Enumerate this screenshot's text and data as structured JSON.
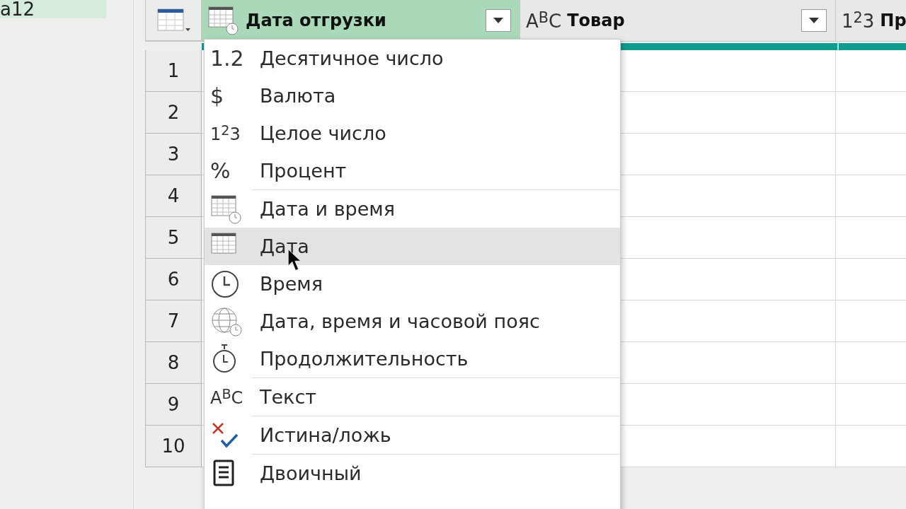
{
  "queries": [
    {
      "name": "а12",
      "selected": true
    }
  ],
  "table": {
    "columns": [
      {
        "name": "Дата отгрузки",
        "kind": "datetime",
        "selected": true,
        "has_dropdown": true
      },
      {
        "name": "Товар",
        "kind": "glyph",
        "glyph": "A$^{B}$C",
        "selected": false,
        "has_dropdown": true
      },
      {
        "name": "Пр",
        "kind": "glyph",
        "glyph": "1$^{2}$3",
        "selected": false
      }
    ],
    "row_numbers": [
      "1",
      "2",
      "3",
      "4",
      "5",
      "6",
      "7",
      "8",
      "9",
      "10"
    ]
  },
  "type_menu": {
    "groups": [
      [
        {
          "kind": "glyph",
          "glyph": "1.2",
          "label": "Десятичное число",
          "selected": false
        },
        {
          "kind": "glyph",
          "glyph": "$",
          "label": "Валюта",
          "selected": false
        },
        {
          "kind": "glyph",
          "glyph": "1$^{2}$3",
          "label": "Целое число",
          "selected": false
        },
        {
          "kind": "glyph",
          "glyph": "%",
          "label": "Процент",
          "selected": false
        }
      ],
      [
        {
          "kind": "datetime",
          "label": "Дата и время",
          "selected": false
        },
        {
          "kind": "date",
          "label": "Дата",
          "selected": true
        },
        {
          "kind": "time",
          "label": "Время",
          "selected": false
        },
        {
          "kind": "timezone",
          "label": "Дата, время и часовой пояс",
          "selected": false
        },
        {
          "kind": "duration",
          "label": "Продолжительность",
          "selected": false
        }
      ],
      [
        {
          "kind": "glyph",
          "glyph": "A$^{B}$C",
          "label": "Текст",
          "selected": false
        }
      ],
      [
        {
          "kind": "boolean",
          "label": "Истина/ложь",
          "selected": false
        }
      ],
      [
        {
          "kind": "binary",
          "label": "Двоичный",
          "selected": false
        }
      ]
    ]
  }
}
